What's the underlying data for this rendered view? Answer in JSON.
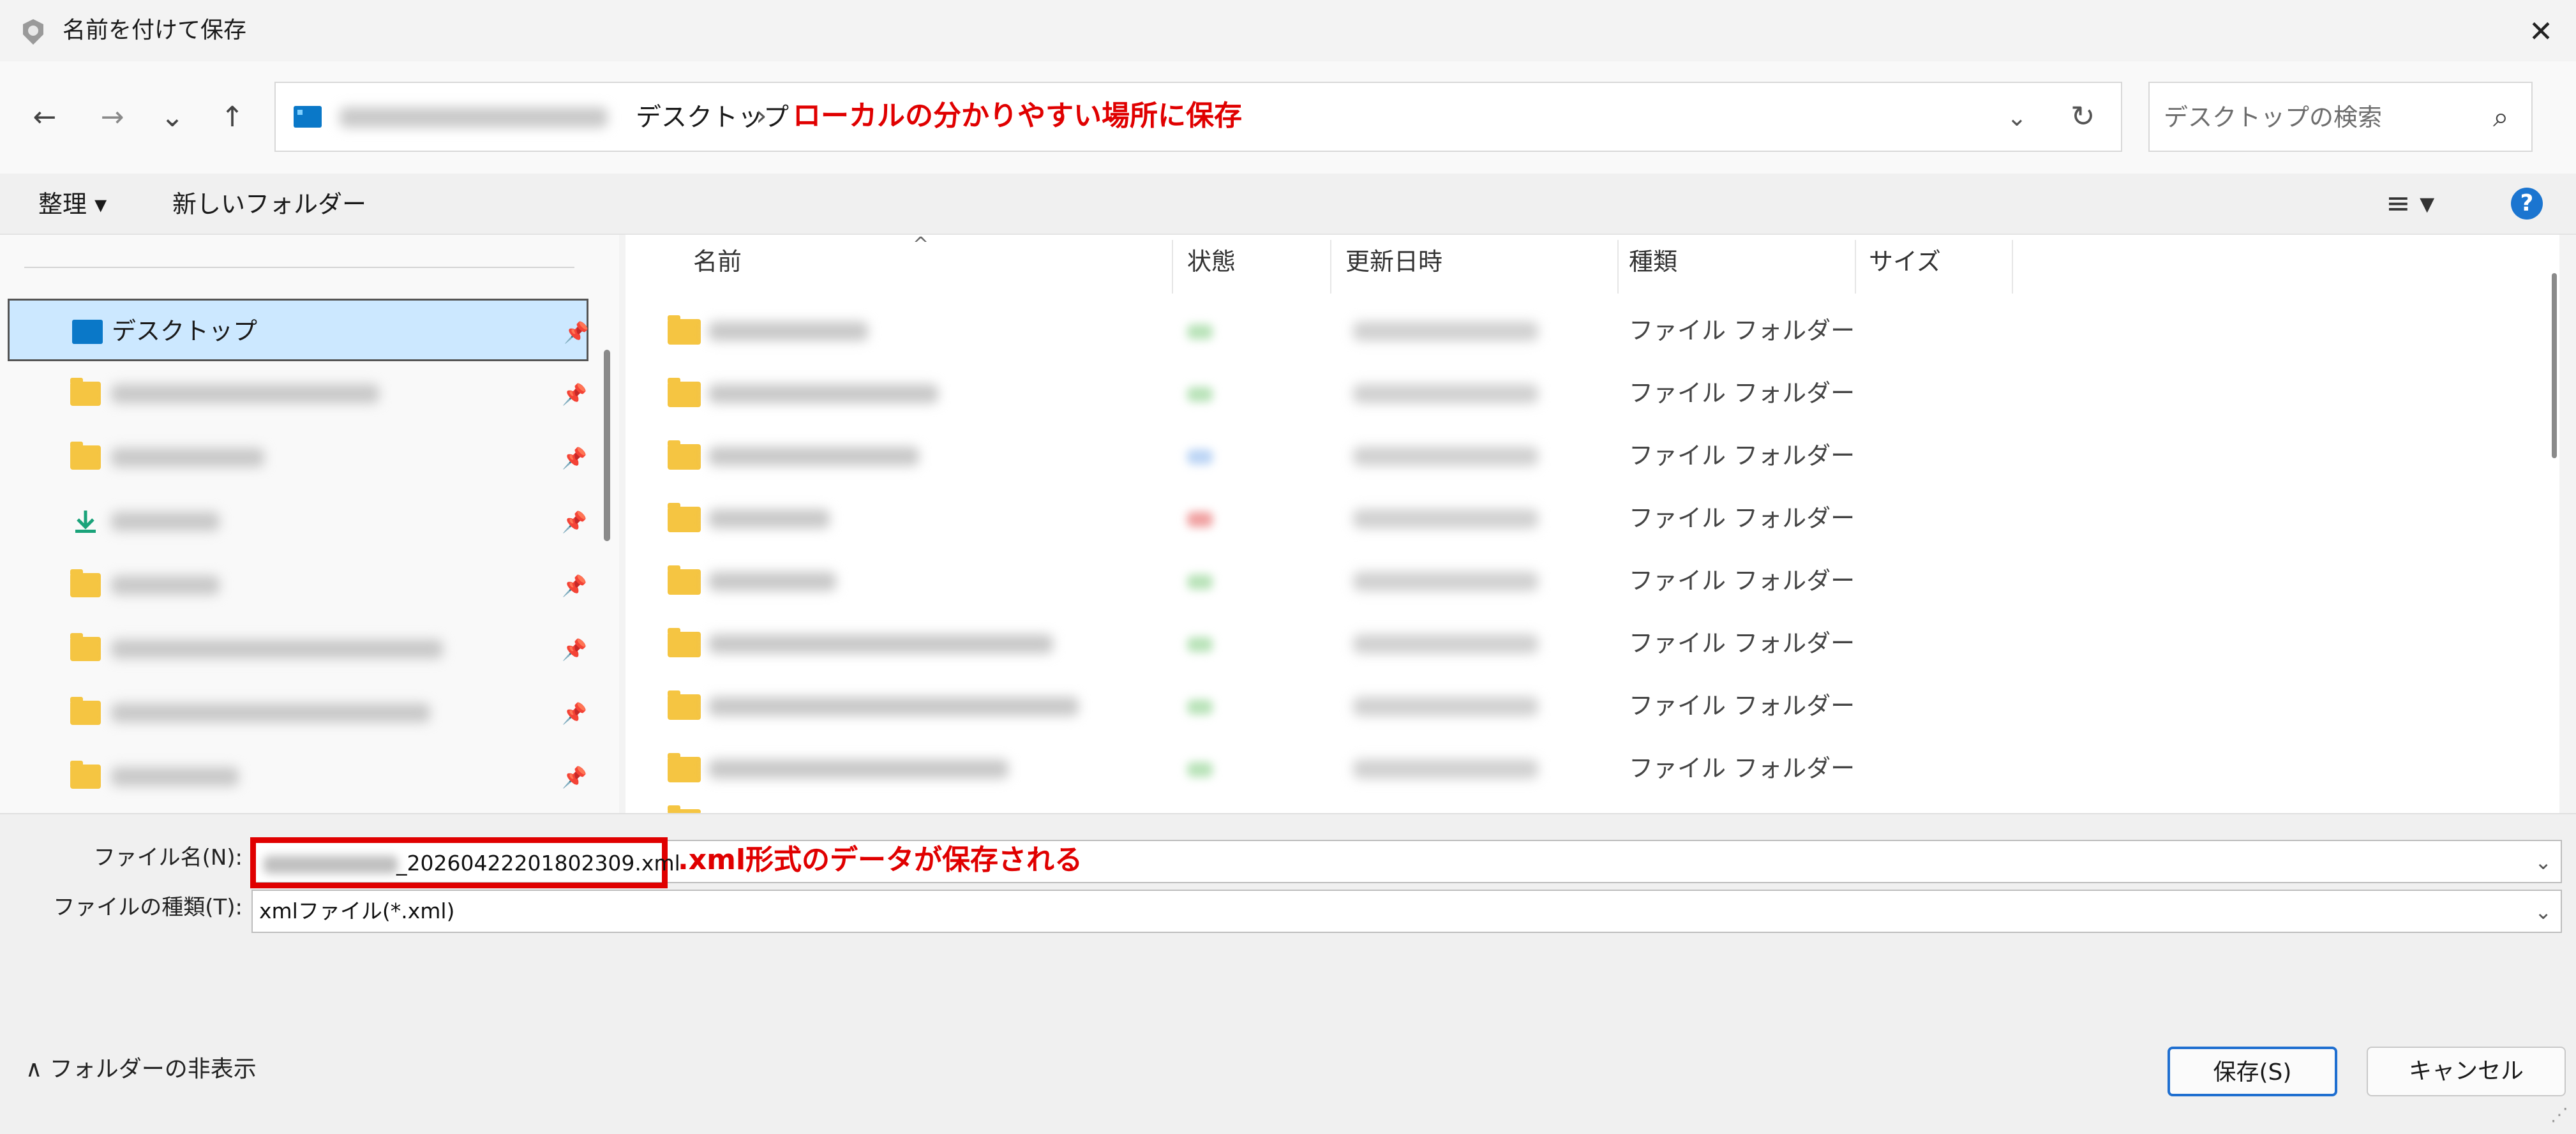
{
  "title_bar": {
    "title": "名前を付けて保存",
    "close": "✕"
  },
  "nav": {
    "back": "←",
    "forward": "→",
    "history": "⌄",
    "up": "↑",
    "breadcrumb_current": "デスクトップ",
    "breadcrumb_sep": "›",
    "annotation": "ローカルの分かりやすい場所に保存",
    "dropdown": "⌄",
    "refresh": "↻"
  },
  "search": {
    "placeholder": "デスクトップの検索",
    "icon": "⌕"
  },
  "toolbar": {
    "organize": "整理 ▾",
    "new_folder": "新しいフォルダー",
    "view": "≡ ▾",
    "help": "?"
  },
  "sidebar": {
    "selected_label": "デスクトップ",
    "pin": "📌"
  },
  "columns": {
    "name": "名前",
    "status": "状態",
    "modified": "更新日時",
    "type": "種類",
    "size": "サイズ",
    "sort": "^"
  },
  "files": [
    {
      "type": "ファイル フォルダー",
      "status_color": "#b9e3b9"
    },
    {
      "type": "ファイル フォルダー",
      "status_color": "#b9e3b9"
    },
    {
      "type": "ファイル フォルダー",
      "status_color": "#bcd5f5"
    },
    {
      "type": "ファイル フォルダー",
      "status_color": "#f0a0a0"
    },
    {
      "type": "ファイル フォルダー",
      "status_color": "#b9e3b9"
    },
    {
      "type": "ファイル フォルダー",
      "status_color": "#b9e3b9"
    },
    {
      "type": "ファイル フォルダー",
      "status_color": "#b9e3b9"
    },
    {
      "type": "ファイル フォルダー",
      "status_color": "#b9e3b9"
    }
  ],
  "form": {
    "filename_label": "ファイル名(N):",
    "filename_value": "_20260422201802309.xml",
    "filename_annotation": ".xml形式のデータが保存される",
    "filetype_label": "ファイルの種類(T):",
    "filetype_value": "xmlファイル(*.xml)",
    "dropdown": "⌄"
  },
  "footer": {
    "hide_folders": "∧  フォルダーの非表示",
    "save": "保存(S)",
    "cancel": "キャンセル"
  },
  "colors": {
    "annotation_red": "#e00000",
    "accent_blue": "#1f6fd0",
    "selection": "#cce8ff",
    "folder": "#f5c542"
  }
}
